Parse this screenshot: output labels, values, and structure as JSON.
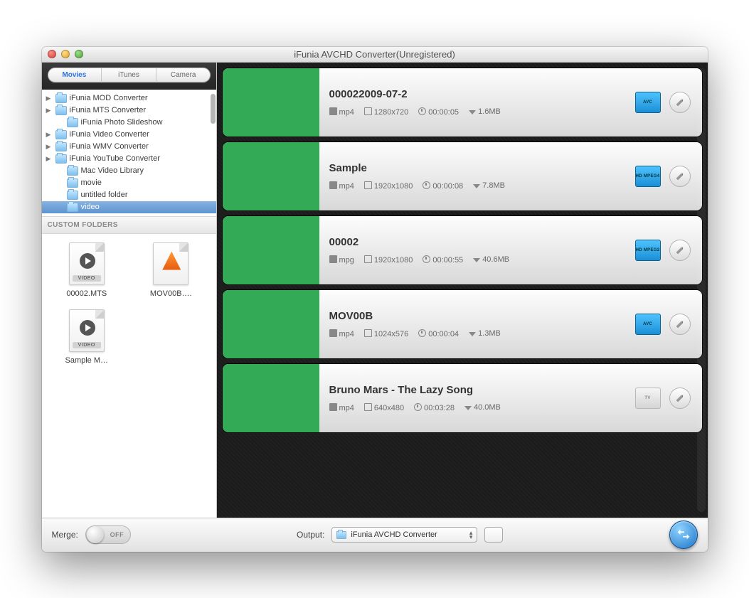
{
  "window": {
    "title": "iFunia AVCHD Converter(Unregistered)"
  },
  "tabs": {
    "movies": "Movies",
    "itunes": "iTunes",
    "camera": "Camera",
    "active": "movies"
  },
  "tree": [
    {
      "label": "iFunia MOD Converter",
      "expandable": true,
      "indent": false
    },
    {
      "label": "iFunia MTS Converter",
      "expandable": true,
      "indent": false
    },
    {
      "label": "iFunia Photo Slideshow",
      "expandable": false,
      "indent": true
    },
    {
      "label": "iFunia Video Converter",
      "expandable": true,
      "indent": false
    },
    {
      "label": "iFunia WMV Converter",
      "expandable": true,
      "indent": false
    },
    {
      "label": "iFunia YouTube Converter",
      "expandable": true,
      "indent": false
    },
    {
      "label": "Mac Video Library",
      "expandable": false,
      "indent": true
    },
    {
      "label": "movie",
      "expandable": false,
      "indent": true
    },
    {
      "label": "untitled folder",
      "expandable": false,
      "indent": true
    },
    {
      "label": "video",
      "expandable": false,
      "indent": true,
      "selected": true
    }
  ],
  "sidebar": {
    "custom_header": "CUSTOM FOLDERS"
  },
  "thumbs": [
    {
      "name": "00002.MTS",
      "kind": "video"
    },
    {
      "name": "MOV00B….",
      "kind": "vlc"
    },
    {
      "name": "Sample M…",
      "kind": "video"
    }
  ],
  "items": [
    {
      "title": "000022009-07-2",
      "format": "mp4",
      "resolution": "1280x720",
      "duration": "00:00:05",
      "size": "1.6MB",
      "badge": "avc",
      "preview": "pv1"
    },
    {
      "title": "Sample",
      "format": "mp4",
      "resolution": "1920x1080",
      "duration": "00:00:08",
      "size": "7.8MB",
      "badge": "mpeg4",
      "preview": "pv2"
    },
    {
      "title": "00002",
      "format": "mpg",
      "resolution": "1920x1080",
      "duration": "00:00:55",
      "size": "40.6MB",
      "badge": "mpeg2",
      "preview": "pv3"
    },
    {
      "title": "MOV00B",
      "format": "mp4",
      "resolution": "1024x576",
      "duration": "00:00:04",
      "size": "1.3MB",
      "badge": "avc",
      "preview": "pv4"
    },
    {
      "title": "Bruno Mars - The Lazy Song",
      "format": "mp4",
      "resolution": "640x480",
      "duration": "00:03:28",
      "size": "40.0MB",
      "badge": "tv",
      "preview": "pv5"
    }
  ],
  "badge_labels": {
    "avc": "AVC",
    "mpeg4": "HD MPEG4",
    "mpeg2": "HD MPEG2",
    "tv": "TV"
  },
  "footer": {
    "merge_label": "Merge:",
    "merge_state": "OFF",
    "output_label": "Output:",
    "output_value": "iFunia AVCHD Converter"
  }
}
